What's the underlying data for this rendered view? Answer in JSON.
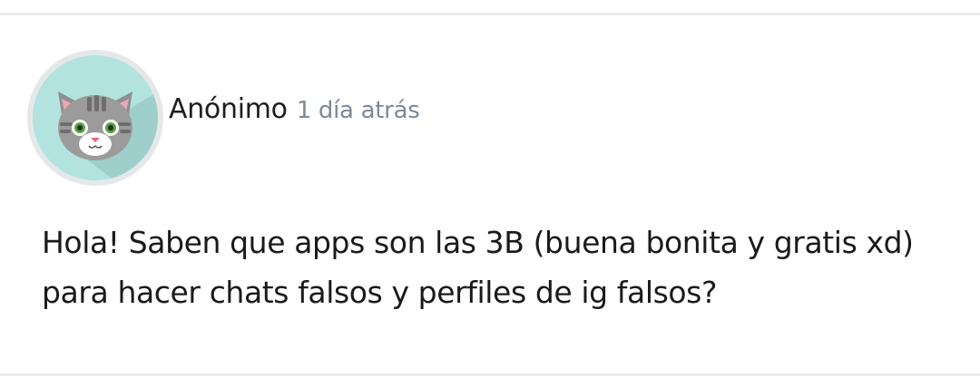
{
  "post": {
    "author": "Anónimo",
    "timestamp": "1 día atrás",
    "avatar_icon": "cat-avatar-icon",
    "body_lines": [
      "Hola! Saben que apps son las 3B (buena bonita y gratis xd)",
      "para hacer chats falsos y perfiles de ig falsos?"
    ]
  },
  "colors": {
    "avatar_background": "#b2e3df",
    "avatar_ring": "#e5e8e9",
    "timestamp_text": "#7c8a95",
    "divider": "#ececec"
  }
}
